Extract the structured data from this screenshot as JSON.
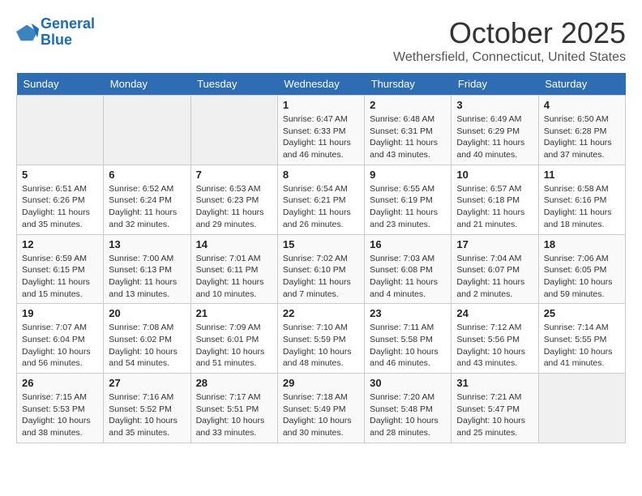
{
  "logo": {
    "line1": "General",
    "line2": "Blue"
  },
  "title": "October 2025",
  "location": "Wethersfield, Connecticut, United States",
  "weekdays": [
    "Sunday",
    "Monday",
    "Tuesday",
    "Wednesday",
    "Thursday",
    "Friday",
    "Saturday"
  ],
  "weeks": [
    [
      {
        "day": "",
        "info": ""
      },
      {
        "day": "",
        "info": ""
      },
      {
        "day": "",
        "info": ""
      },
      {
        "day": "1",
        "info": "Sunrise: 6:47 AM\nSunset: 6:33 PM\nDaylight: 11 hours\nand 46 minutes."
      },
      {
        "day": "2",
        "info": "Sunrise: 6:48 AM\nSunset: 6:31 PM\nDaylight: 11 hours\nand 43 minutes."
      },
      {
        "day": "3",
        "info": "Sunrise: 6:49 AM\nSunset: 6:29 PM\nDaylight: 11 hours\nand 40 minutes."
      },
      {
        "day": "4",
        "info": "Sunrise: 6:50 AM\nSunset: 6:28 PM\nDaylight: 11 hours\nand 37 minutes."
      }
    ],
    [
      {
        "day": "5",
        "info": "Sunrise: 6:51 AM\nSunset: 6:26 PM\nDaylight: 11 hours\nand 35 minutes."
      },
      {
        "day": "6",
        "info": "Sunrise: 6:52 AM\nSunset: 6:24 PM\nDaylight: 11 hours\nand 32 minutes."
      },
      {
        "day": "7",
        "info": "Sunrise: 6:53 AM\nSunset: 6:23 PM\nDaylight: 11 hours\nand 29 minutes."
      },
      {
        "day": "8",
        "info": "Sunrise: 6:54 AM\nSunset: 6:21 PM\nDaylight: 11 hours\nand 26 minutes."
      },
      {
        "day": "9",
        "info": "Sunrise: 6:55 AM\nSunset: 6:19 PM\nDaylight: 11 hours\nand 23 minutes."
      },
      {
        "day": "10",
        "info": "Sunrise: 6:57 AM\nSunset: 6:18 PM\nDaylight: 11 hours\nand 21 minutes."
      },
      {
        "day": "11",
        "info": "Sunrise: 6:58 AM\nSunset: 6:16 PM\nDaylight: 11 hours\nand 18 minutes."
      }
    ],
    [
      {
        "day": "12",
        "info": "Sunrise: 6:59 AM\nSunset: 6:15 PM\nDaylight: 11 hours\nand 15 minutes."
      },
      {
        "day": "13",
        "info": "Sunrise: 7:00 AM\nSunset: 6:13 PM\nDaylight: 11 hours\nand 13 minutes."
      },
      {
        "day": "14",
        "info": "Sunrise: 7:01 AM\nSunset: 6:11 PM\nDaylight: 11 hours\nand 10 minutes."
      },
      {
        "day": "15",
        "info": "Sunrise: 7:02 AM\nSunset: 6:10 PM\nDaylight: 11 hours\nand 7 minutes."
      },
      {
        "day": "16",
        "info": "Sunrise: 7:03 AM\nSunset: 6:08 PM\nDaylight: 11 hours\nand 4 minutes."
      },
      {
        "day": "17",
        "info": "Sunrise: 7:04 AM\nSunset: 6:07 PM\nDaylight: 11 hours\nand 2 minutes."
      },
      {
        "day": "18",
        "info": "Sunrise: 7:06 AM\nSunset: 6:05 PM\nDaylight: 10 hours\nand 59 minutes."
      }
    ],
    [
      {
        "day": "19",
        "info": "Sunrise: 7:07 AM\nSunset: 6:04 PM\nDaylight: 10 hours\nand 56 minutes."
      },
      {
        "day": "20",
        "info": "Sunrise: 7:08 AM\nSunset: 6:02 PM\nDaylight: 10 hours\nand 54 minutes."
      },
      {
        "day": "21",
        "info": "Sunrise: 7:09 AM\nSunset: 6:01 PM\nDaylight: 10 hours\nand 51 minutes."
      },
      {
        "day": "22",
        "info": "Sunrise: 7:10 AM\nSunset: 5:59 PM\nDaylight: 10 hours\nand 48 minutes."
      },
      {
        "day": "23",
        "info": "Sunrise: 7:11 AM\nSunset: 5:58 PM\nDaylight: 10 hours\nand 46 minutes."
      },
      {
        "day": "24",
        "info": "Sunrise: 7:12 AM\nSunset: 5:56 PM\nDaylight: 10 hours\nand 43 minutes."
      },
      {
        "day": "25",
        "info": "Sunrise: 7:14 AM\nSunset: 5:55 PM\nDaylight: 10 hours\nand 41 minutes."
      }
    ],
    [
      {
        "day": "26",
        "info": "Sunrise: 7:15 AM\nSunset: 5:53 PM\nDaylight: 10 hours\nand 38 minutes."
      },
      {
        "day": "27",
        "info": "Sunrise: 7:16 AM\nSunset: 5:52 PM\nDaylight: 10 hours\nand 35 minutes."
      },
      {
        "day": "28",
        "info": "Sunrise: 7:17 AM\nSunset: 5:51 PM\nDaylight: 10 hours\nand 33 minutes."
      },
      {
        "day": "29",
        "info": "Sunrise: 7:18 AM\nSunset: 5:49 PM\nDaylight: 10 hours\nand 30 minutes."
      },
      {
        "day": "30",
        "info": "Sunrise: 7:20 AM\nSunset: 5:48 PM\nDaylight: 10 hours\nand 28 minutes."
      },
      {
        "day": "31",
        "info": "Sunrise: 7:21 AM\nSunset: 5:47 PM\nDaylight: 10 hours\nand 25 minutes."
      },
      {
        "day": "",
        "info": ""
      }
    ]
  ]
}
